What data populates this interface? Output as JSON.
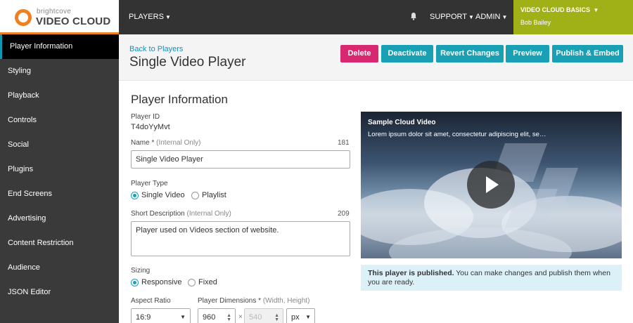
{
  "brand": {
    "small": "brightcove",
    "name": "VIDEO CLOUD"
  },
  "topnav": {
    "players": "PLAYERS",
    "support": "SUPPORT",
    "admin": "ADMIN",
    "account_title": "VIDEO CLOUD BASICS",
    "account_user": "Bob Bailey"
  },
  "sidebar": {
    "items": [
      "Player Information",
      "Styling",
      "Playback",
      "Controls",
      "Social",
      "Plugins",
      "End Screens",
      "Advertising",
      "Content Restriction",
      "Audience",
      "JSON Editor"
    ]
  },
  "header": {
    "back_link": "Back to Players",
    "title": "Single Video Player",
    "buttons": {
      "delete": "Delete",
      "deactivate": "Deactivate",
      "revert": "Revert Changes",
      "preview": "Preview",
      "publish": "Publish & Embed"
    }
  },
  "form": {
    "section_title": "Player Information",
    "player_id_label": "Player ID",
    "player_id_value": "T4doYyMvt",
    "name_label": "Name *",
    "name_hint": "(Internal Only)",
    "name_count": "181",
    "name_value": "Single Video Player",
    "type_label": "Player Type",
    "type_single": "Single Video",
    "type_playlist": "Playlist",
    "desc_label": "Short Description",
    "desc_hint": "(Internal Only)",
    "desc_count": "209",
    "desc_value": "Player used on Videos section of website.",
    "sizing_label": "Sizing",
    "sizing_responsive": "Responsive",
    "sizing_fixed": "Fixed",
    "aspect_label": "Aspect Ratio",
    "aspect_value": "16:9",
    "dims_label": "Player Dimensions *",
    "dims_hint": "(Width, Height)",
    "width_value": "960",
    "height_value": "540",
    "unit_value": "px",
    "dims_separator": "×"
  },
  "video": {
    "title": "Sample Cloud Video",
    "description": "Lorem ipsum dolor sit amet, consectetur adipiscing elit, se…"
  },
  "notice": {
    "bold": "This player is published.",
    "text": " You can make changes and publish them when you are ready."
  },
  "colors": {
    "accent": "#1aa0b4",
    "delete": "#d8286f",
    "account": "#a0b017",
    "brand_orange": "#f0801f"
  }
}
